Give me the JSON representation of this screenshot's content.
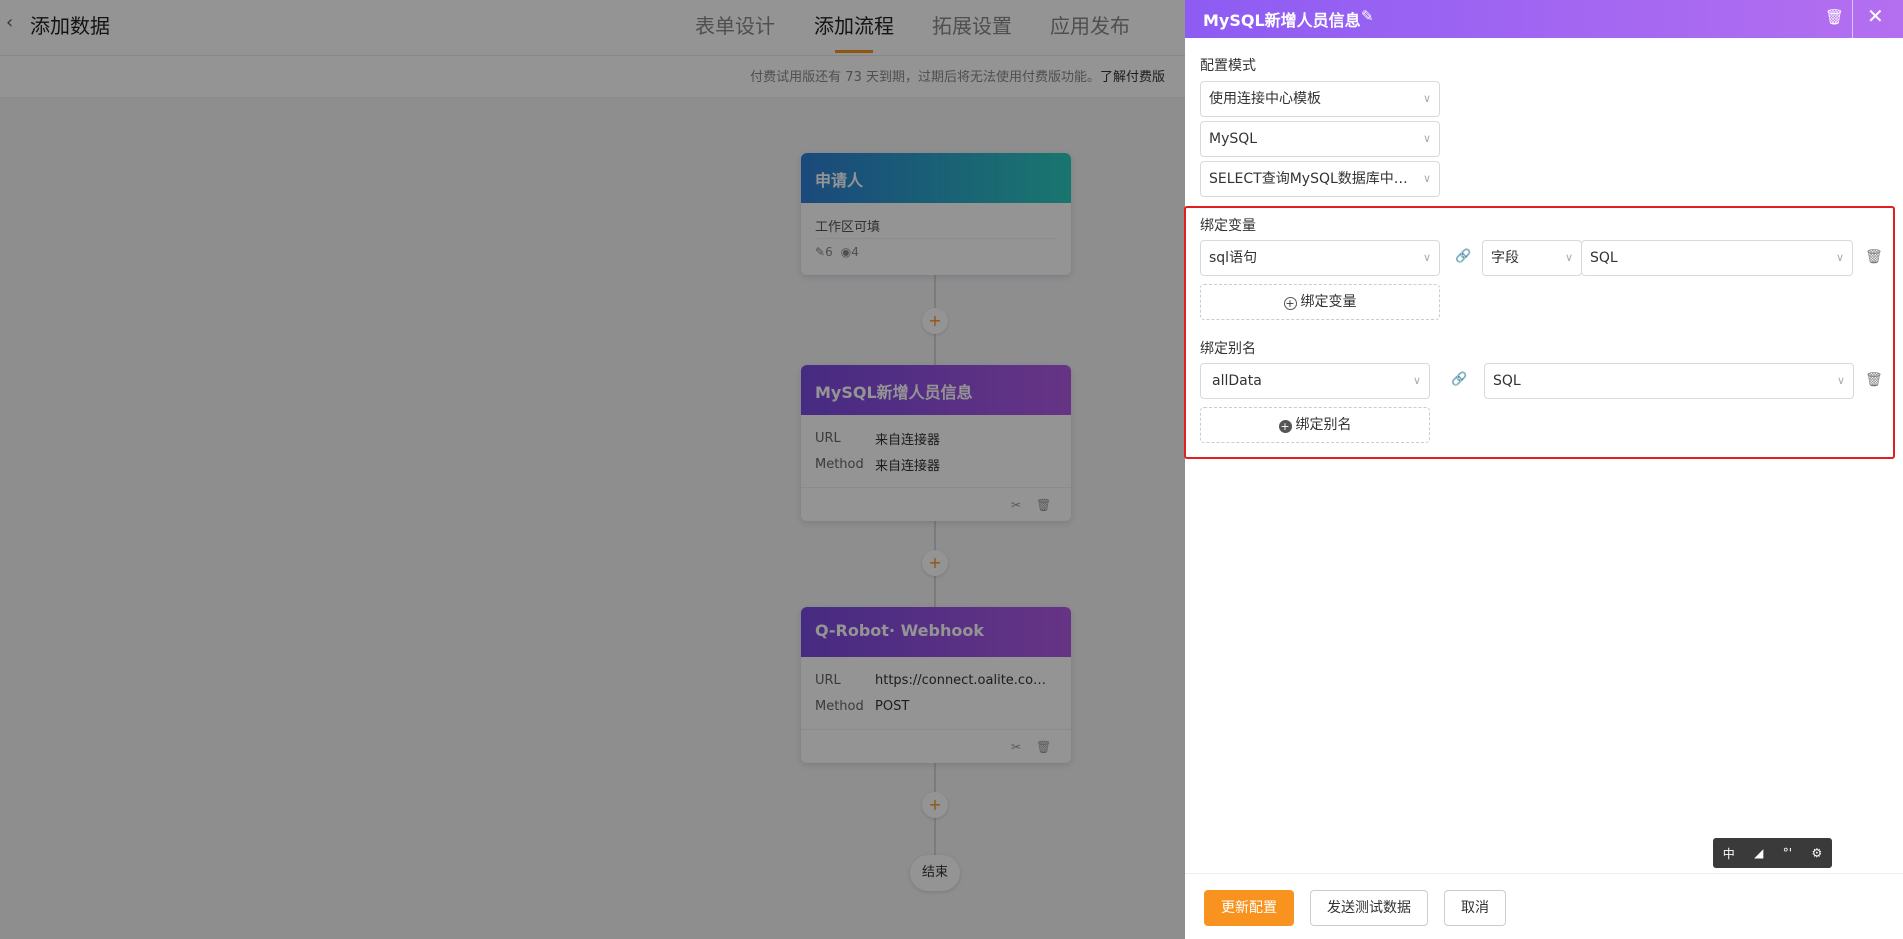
{
  "app": {
    "back_label": "‹",
    "title": "添加数据",
    "tabs": [
      {
        "label": "表单设计"
      },
      {
        "label": "添加流程"
      },
      {
        "label": "拓展设置"
      },
      {
        "label": "应用发布"
      }
    ],
    "notice": "付费试用版还有 73 天到期，过期后将无法使用付费版功能。",
    "notice_link": "了解付费版"
  },
  "flow": {
    "nodes": [
      {
        "title": "申请人",
        "sub": "工作区可填",
        "edit_count": "6",
        "view_count": "4"
      },
      {
        "title": "MySQL新增人员信息",
        "rows": [
          {
            "k": "URL",
            "v": "来自连接器"
          },
          {
            "k": "Method",
            "v": "来自连接器"
          }
        ]
      },
      {
        "title": "Q-Robot· Webhook",
        "rows": [
          {
            "k": "URL",
            "v": "https://connect.oalite.com…"
          },
          {
            "k": "Method",
            "v": "POST"
          }
        ]
      }
    ],
    "end_label": "结束",
    "plus": "+"
  },
  "drawer": {
    "title": "MySQL新增人员信息",
    "config_mode_label": "配置模式",
    "config_template": "使用连接中心模板",
    "db_type": "MySQL",
    "query_template": "SELECT查询MySQL数据库中…",
    "bind_var_label": "绑定变量",
    "bind_var": {
      "name": "sql语句",
      "source": "字段",
      "value": "SQL"
    },
    "add_var_label": "绑定变量",
    "bind_alias_label": "绑定别名",
    "bind_alias": {
      "name": "allData",
      "value": "SQL"
    },
    "add_alias_label": "绑定别名",
    "footer": {
      "update": "更新配置",
      "send_test": "发送测试数据",
      "cancel": "取消"
    }
  },
  "toolbar": {
    "items": [
      "中",
      "◢",
      "°'",
      "⚙"
    ]
  },
  "colors": {
    "accent": "#f7931e",
    "purple": "#8d5cf3",
    "highlight": "#e02020"
  }
}
